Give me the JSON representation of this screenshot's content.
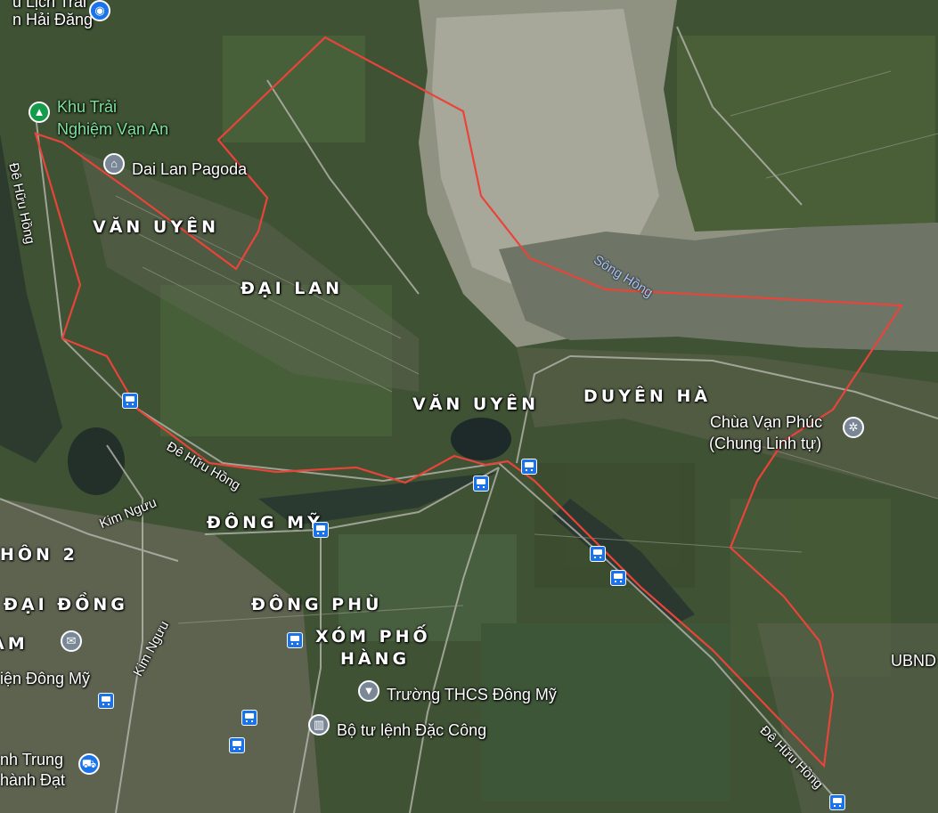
{
  "map": {
    "area_labels": {
      "van_uyen_1": "VĂN UYÊN",
      "dai_lan": "ĐẠI LAN",
      "van_uyen_2": "VĂN UYÊN",
      "duyen_ha": "DUYÊN HÀ",
      "dong_my": "ĐÔNG MỸ",
      "dong_phu": "ĐÔNG PHÙ",
      "xom_pho_hang_1": "XÓM PHỐ",
      "xom_pho_hang_2": "HÀNG",
      "thon_2": "HÔN 2",
      "dai_dong": "ĐẠI ĐỒNG",
      "m_fragment": "AM"
    },
    "pois": {
      "hai_dang_top": "u Lịch Trải",
      "hai_dang_bottom": "n Hải Đăng",
      "khu_trai_1": "Khu Trải",
      "khu_trai_2": "Nghiệm Vạn An",
      "dai_lan_pagoda": "Dai Lan Pagoda",
      "chua_van_phuc_1": "Chùa Vạn Phúc",
      "chua_van_phuc_2": "(Chung Linh tự)",
      "truong_thcs": "Trường THCS Đông Mỹ",
      "bo_tu_lenh": "Bộ tư lệnh Đặc Công",
      "buu_dien": "iện Đông Mỹ",
      "trung_1": "nh Trung",
      "trung_2": "hành Đạt",
      "ubnd": "UBND"
    },
    "roads": {
      "de_huu_hong_left": "Đê Hữu Hồng",
      "de_huu_hong_mid": "Đê Hữu Hồng",
      "de_huu_hong_right": "Đê Hữu Hồng",
      "kim_nguu_1": "Kim Ngưu",
      "kim_nguu_2": "Kim Ngưu"
    },
    "water": {
      "song_hong": "Sông Hồng"
    },
    "colors": {
      "boundary": "#e8443a",
      "river": "#6e7566",
      "sandbar": "#a8a89a",
      "bus_stop": "#1a73e8",
      "camp_pin": "#159c4a"
    },
    "icons": [
      "camera-icon",
      "camp-icon",
      "temple-icon",
      "dharma-wheel-icon",
      "school-icon",
      "government-icon",
      "shopping-icon",
      "post-office-icon",
      "bus-stop-icon"
    ]
  }
}
